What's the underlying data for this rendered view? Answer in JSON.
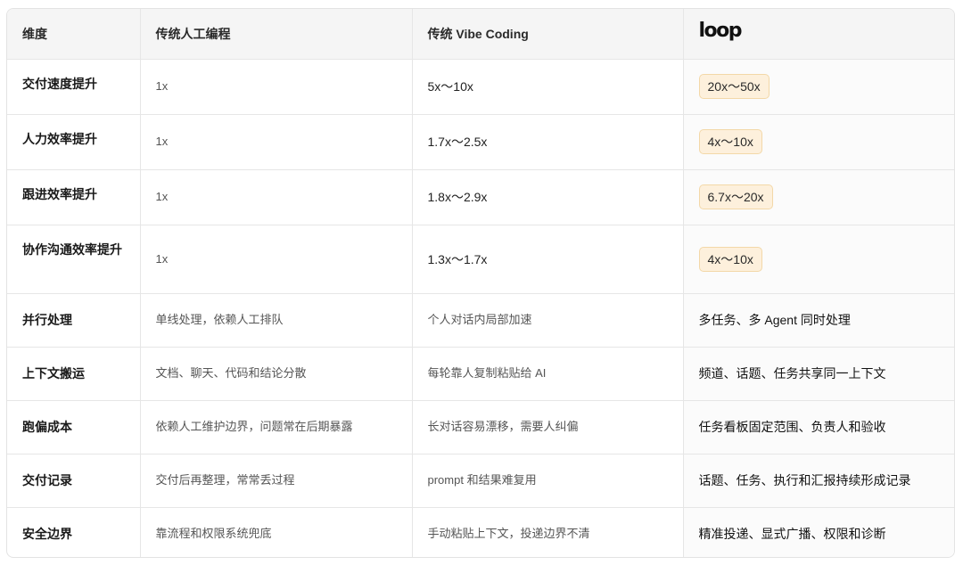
{
  "header": {
    "dimension": "维度",
    "traditional": "传统人工编程",
    "vibe": "传统 Vibe Coding",
    "loop_logo": "loop"
  },
  "rows": [
    {
      "dimension": "交付速度提升",
      "traditional": "1x",
      "vibe": "5x〜10x",
      "loop": "20x〜50x",
      "highlight": true
    },
    {
      "dimension": "人力效率提升",
      "traditional": "1x",
      "vibe": "1.7x〜2.5x",
      "loop": "4x〜10x",
      "highlight": true
    },
    {
      "dimension": "跟进效率提升",
      "traditional": "1x",
      "vibe": "1.8x〜2.9x",
      "loop": "6.7x〜20x",
      "highlight": true
    },
    {
      "dimension": "协作沟通效率提升",
      "traditional": "1x",
      "vibe": "1.3x〜1.7x",
      "loop": "4x〜10x",
      "highlight": true
    },
    {
      "dimension": "并行处理",
      "traditional": "单线处理，依赖人工排队",
      "vibe": "个人对话内局部加速",
      "loop": "多任务、多 Agent 同时处理",
      "highlight": false
    },
    {
      "dimension": "上下文搬运",
      "traditional": "文档、聊天、代码和结论分散",
      "vibe": "每轮靠人复制粘贴给 AI",
      "loop": "频道、话题、任务共享同一上下文",
      "highlight": false
    },
    {
      "dimension": "跑偏成本",
      "traditional": "依赖人工维护边界，问题常在后期暴露",
      "vibe": "长对话容易漂移，需要人纠偏",
      "loop": "任务看板固定范围、负责人和验收",
      "highlight": false
    },
    {
      "dimension": "交付记录",
      "traditional": "交付后再整理，常常丢过程",
      "vibe": "prompt 和结果难复用",
      "loop": "话题、任务、执行和汇报持续形成记录",
      "highlight": false
    },
    {
      "dimension": "安全边界",
      "traditional": "靠流程和权限系统兜底",
      "vibe": "手动粘贴上下文，投递边界不清",
      "loop": "精准投递、显式广播、权限和诊断",
      "highlight": false
    }
  ],
  "colors": {
    "header_bg": "#f5f5f5",
    "pill_bg": "#fdf0dc",
    "pill_border": "#f3d8a8",
    "border": "#e6e6e6"
  }
}
